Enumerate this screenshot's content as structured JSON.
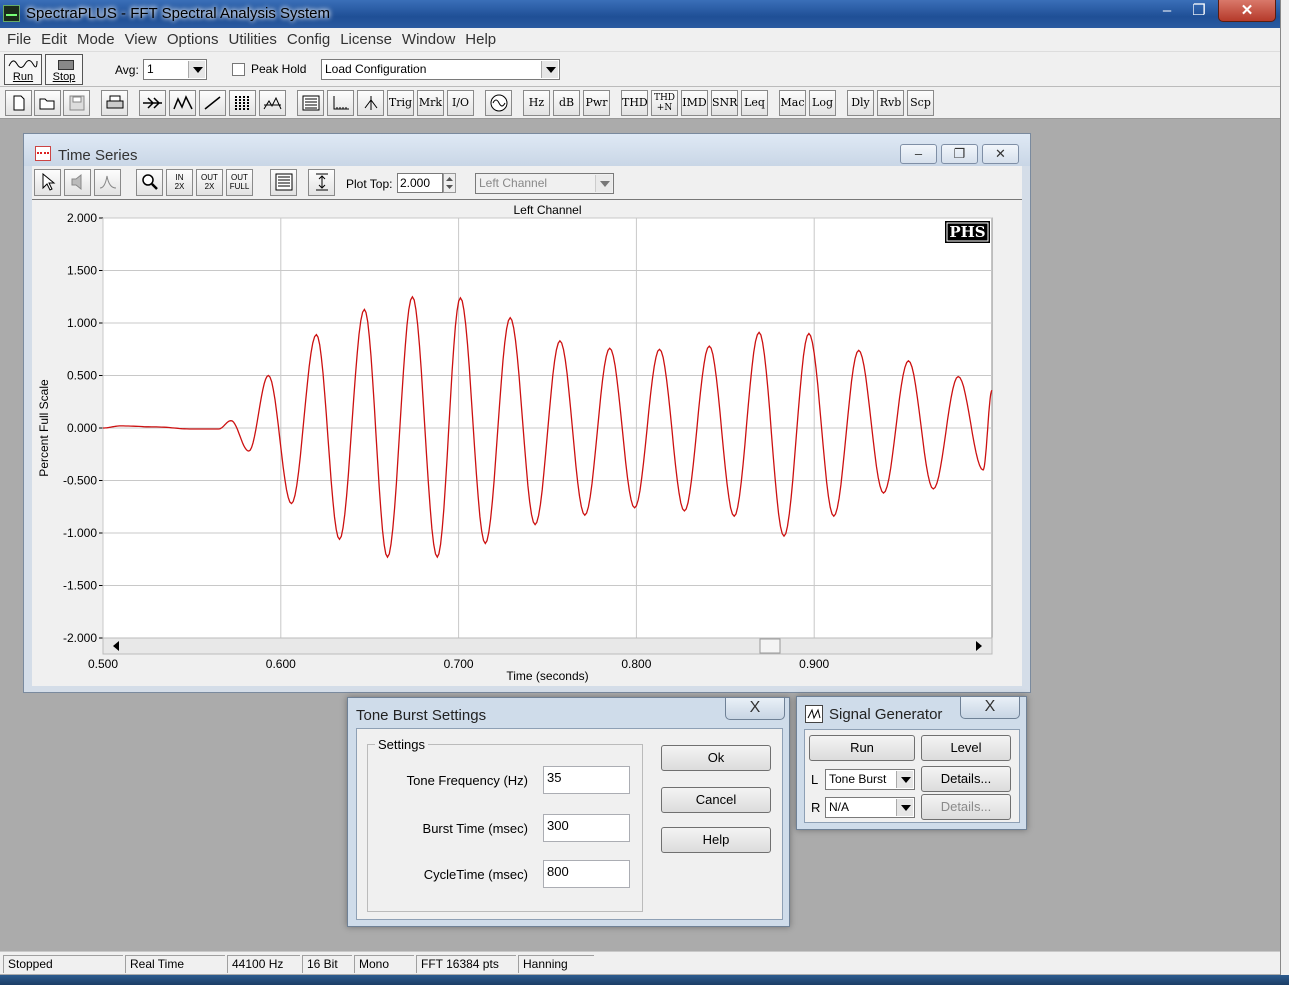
{
  "app": {
    "title": "SpectraPLUS - FFT Spectral Analysis System"
  },
  "window_controls": {
    "minimize": "–",
    "maximize": "❐",
    "close": "✕"
  },
  "menu": [
    "File",
    "Edit",
    "Mode",
    "View",
    "Options",
    "Utilities",
    "Config",
    "License",
    "Window",
    "Help"
  ],
  "toolbar1": {
    "run_label": "Run",
    "stop_label": "Stop",
    "avg_label": "Avg:",
    "avg_value": "1",
    "peak_hold_label": "Peak Hold",
    "peak_hold_checked": false,
    "config_value": "Load Configuration"
  },
  "toolbar2": {
    "buttons": [
      "Trig",
      "Mrk",
      "I/O",
      "Hz",
      "dB",
      "Pwr",
      "THD",
      "THD +N",
      "IMD",
      "SNR",
      "Leq",
      "Mac",
      "Log",
      "Dly",
      "Rvb",
      "Scp"
    ]
  },
  "time_series": {
    "title": "Time Series",
    "plot_top_label": "Plot Top:",
    "plot_top_value": "2.000",
    "channel_value": "Left Channel",
    "zoom_buttons": {
      "in2x_top": "IN",
      "in2x_bottom": "2X",
      "out2x_top": "OUT",
      "out2x_bottom": "2X",
      "outfull_top": "OUT",
      "outfull_bottom": "FULL"
    }
  },
  "chart_data": {
    "type": "line",
    "title": "Left Channel",
    "xlabel": "Time (seconds)",
    "ylabel": "Percent Full Scale",
    "xlim": [
      0.5,
      1.0
    ],
    "ylim": [
      -2.0,
      2.0
    ],
    "x_ticks": [
      "0.500",
      "0.600",
      "0.700",
      "0.800",
      "0.900"
    ],
    "x_tick_values": [
      0.5,
      0.6,
      0.7,
      0.8,
      0.9
    ],
    "y_ticks": [
      "2.000",
      "1.500",
      "1.000",
      "0.500",
      "0.000",
      "-0.500",
      "-1.000",
      "-1.500",
      "-2.000"
    ],
    "y_tick_values": [
      2.0,
      1.5,
      1.0,
      0.5,
      0.0,
      -0.5,
      -1.0,
      -1.5,
      -2.0
    ],
    "grid": true,
    "badge": "PHS",
    "line_color": "#cc1111",
    "series": [
      {
        "extrema": [
          [
            0.5,
            0.0
          ],
          [
            0.51,
            0.02
          ],
          [
            0.53,
            0.01
          ],
          [
            0.55,
            -0.01
          ],
          [
            0.565,
            -0.01
          ],
          [
            0.572,
            0.07
          ],
          [
            0.582,
            -0.22
          ],
          [
            0.593,
            0.5
          ],
          [
            0.606,
            -0.72
          ],
          [
            0.62,
            0.89
          ],
          [
            0.633,
            -1.06
          ],
          [
            0.647,
            1.13
          ],
          [
            0.66,
            -1.23
          ],
          [
            0.674,
            1.25
          ],
          [
            0.688,
            -1.23
          ],
          [
            0.701,
            1.24
          ],
          [
            0.715,
            -1.1
          ],
          [
            0.729,
            1.05
          ],
          [
            0.743,
            -0.92
          ],
          [
            0.757,
            0.83
          ],
          [
            0.771,
            -0.83
          ],
          [
            0.785,
            0.76
          ],
          [
            0.799,
            -0.76
          ],
          [
            0.813,
            0.75
          ],
          [
            0.827,
            -0.79
          ],
          [
            0.841,
            0.78
          ],
          [
            0.855,
            -0.84
          ],
          [
            0.869,
            0.91
          ],
          [
            0.883,
            -1.03
          ],
          [
            0.897,
            0.9
          ],
          [
            0.911,
            -0.84
          ],
          [
            0.925,
            0.74
          ],
          [
            0.939,
            -0.62
          ],
          [
            0.953,
            0.64
          ],
          [
            0.967,
            -0.58
          ],
          [
            0.981,
            0.49
          ],
          [
            0.995,
            -0.4
          ],
          [
            1.0,
            0.36
          ]
        ]
      }
    ]
  },
  "tone_burst": {
    "title": "Tone Burst Settings",
    "group_label": "Settings",
    "tone_freq_label": "Tone Frequency (Hz)",
    "tone_freq_value": "35",
    "burst_time_label": "Burst Time (msec)",
    "burst_time_value": "300",
    "cycle_time_label": "CycleTime (msec)",
    "cycle_time_value": "800",
    "ok_label": "Ok",
    "cancel_label": "Cancel",
    "help_label": "Help",
    "close_label": "X"
  },
  "signal_generator": {
    "title": "Signal Generator",
    "run_label": "Run",
    "level_label": "Level",
    "left_label": "L",
    "left_value": "Tone Burst",
    "left_details": "Details...",
    "right_label": "R",
    "right_value": "N/A",
    "right_details": "Details...",
    "close_label": "X"
  },
  "status": [
    "Stopped",
    "Real Time",
    "44100 Hz",
    "16 Bit",
    "Mono",
    "FFT 16384 pts",
    "Hanning"
  ]
}
